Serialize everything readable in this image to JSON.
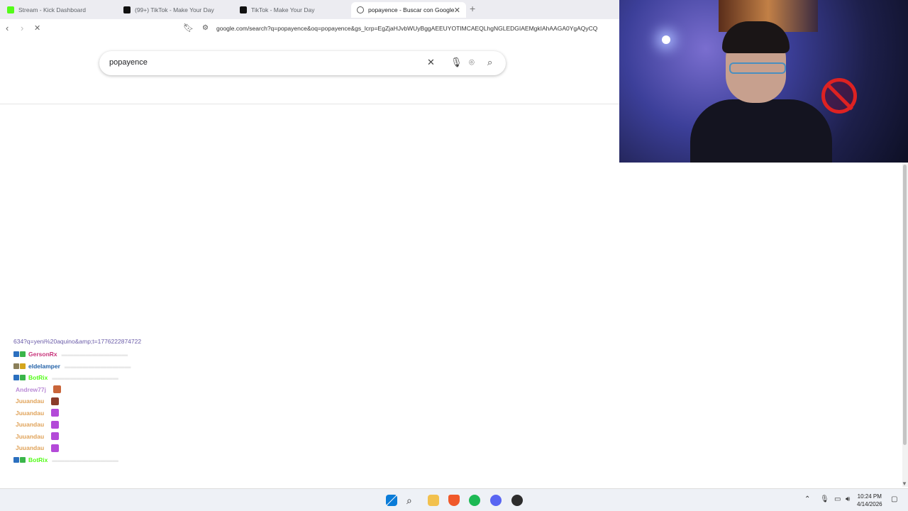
{
  "browser": {
    "tabs": [
      {
        "title": "Stream - Kick Dashboard",
        "favicon": "kick-icon",
        "color": "#53fc18"
      },
      {
        "title": "(99+) TikTok - Make Your Day",
        "favicon": "tiktok-icon",
        "color": "#000000"
      },
      {
        "title": "TikTok - Make Your Day",
        "favicon": "tiktok-icon",
        "color": "#000000"
      },
      {
        "title": "popayence - Buscar con Google",
        "favicon": "google-icon",
        "color": "#4285f4"
      }
    ],
    "new_tab_label": "+",
    "url": "google.com/search?q=popayence&oq=popayence&gs_lcrp=EgZjaHJvbWUyBggAEEUYOTIMCAEQLhgNGLEDGIAEMgkIAhAAGA0YgAQyCQ"
  },
  "search": {
    "query": "popayence"
  },
  "chat": {
    "link_text": "634?q=yeni%20aquino&amp;t=1776222874722",
    "messages": [
      {
        "user": "GersonRx",
        "color": "#c8337a",
        "badges": [
          "#2b6fbf",
          "#3ab54a"
        ],
        "text": "faded"
      },
      {
        "user": "eldelamper",
        "color": "#2563a8",
        "badges": [
          "#8a7f5a",
          "#d4a51c"
        ],
        "text": "faded"
      },
      {
        "user": "BotRix",
        "color": "#53fc18",
        "badges": [
          "#2b6fbf",
          "#3ab54a"
        ],
        "text": "faded"
      },
      {
        "user": "Andrew77j",
        "color": "#b98ad6",
        "badges": [],
        "emote": "#c9653a"
      },
      {
        "user": "Juuandau",
        "color": "#e0a35a",
        "badges": [],
        "emote": "#8a3b2a"
      },
      {
        "user": "Juuandau",
        "color": "#e0a35a",
        "badges": [],
        "emote": "#b34ad8"
      },
      {
        "user": "Juuandau",
        "color": "#e0a35a",
        "badges": [],
        "emote": "#b34ad8"
      },
      {
        "user": "Juuandau",
        "color": "#e0a35a",
        "badges": [],
        "emote": "#b34ad8"
      },
      {
        "user": "Juuandau",
        "color": "#e0a35a",
        "badges": [],
        "emote": "#b34ad8"
      },
      {
        "user": "BotRix",
        "color": "#53fc18",
        "badges": [
          "#2b6fbf",
          "#3ab54a"
        ],
        "text": "faded"
      }
    ]
  },
  "taskbar": {
    "time": "10:24 PM",
    "date": "4/14/2026",
    "apps": [
      "windows-start-icon",
      "search-icon",
      "file-explorer-icon",
      "brave-icon",
      "spotify-icon",
      "discord-icon",
      "app-icon"
    ]
  }
}
